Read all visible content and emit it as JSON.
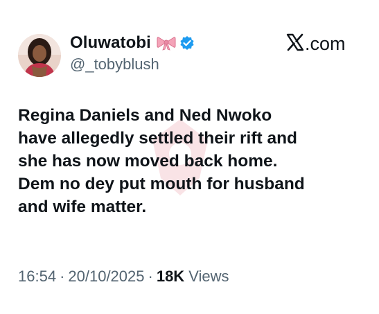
{
  "author": {
    "display_name": "Oluwatobi",
    "handle": "@_tobyblush",
    "name_emoji": "ribbon-bow-icon",
    "verified": true,
    "verified_color": "#1d9bf0"
  },
  "brand": {
    "label": ".com",
    "logo": "x-logo-icon"
  },
  "tweet": {
    "lines": [
      "Regina Daniels and Ned Nwoko",
      "have allegedly settled their rift and",
      "she has now moved back home.",
      "Dem no dey put mouth for husband",
      "and wife matter."
    ]
  },
  "meta": {
    "time": "16:54",
    "date": "20/10/2025",
    "separator": "·",
    "views_count": "18K",
    "views_label": "Views"
  },
  "watermark": {
    "text": "instablog",
    "color": "#e05a6a"
  }
}
